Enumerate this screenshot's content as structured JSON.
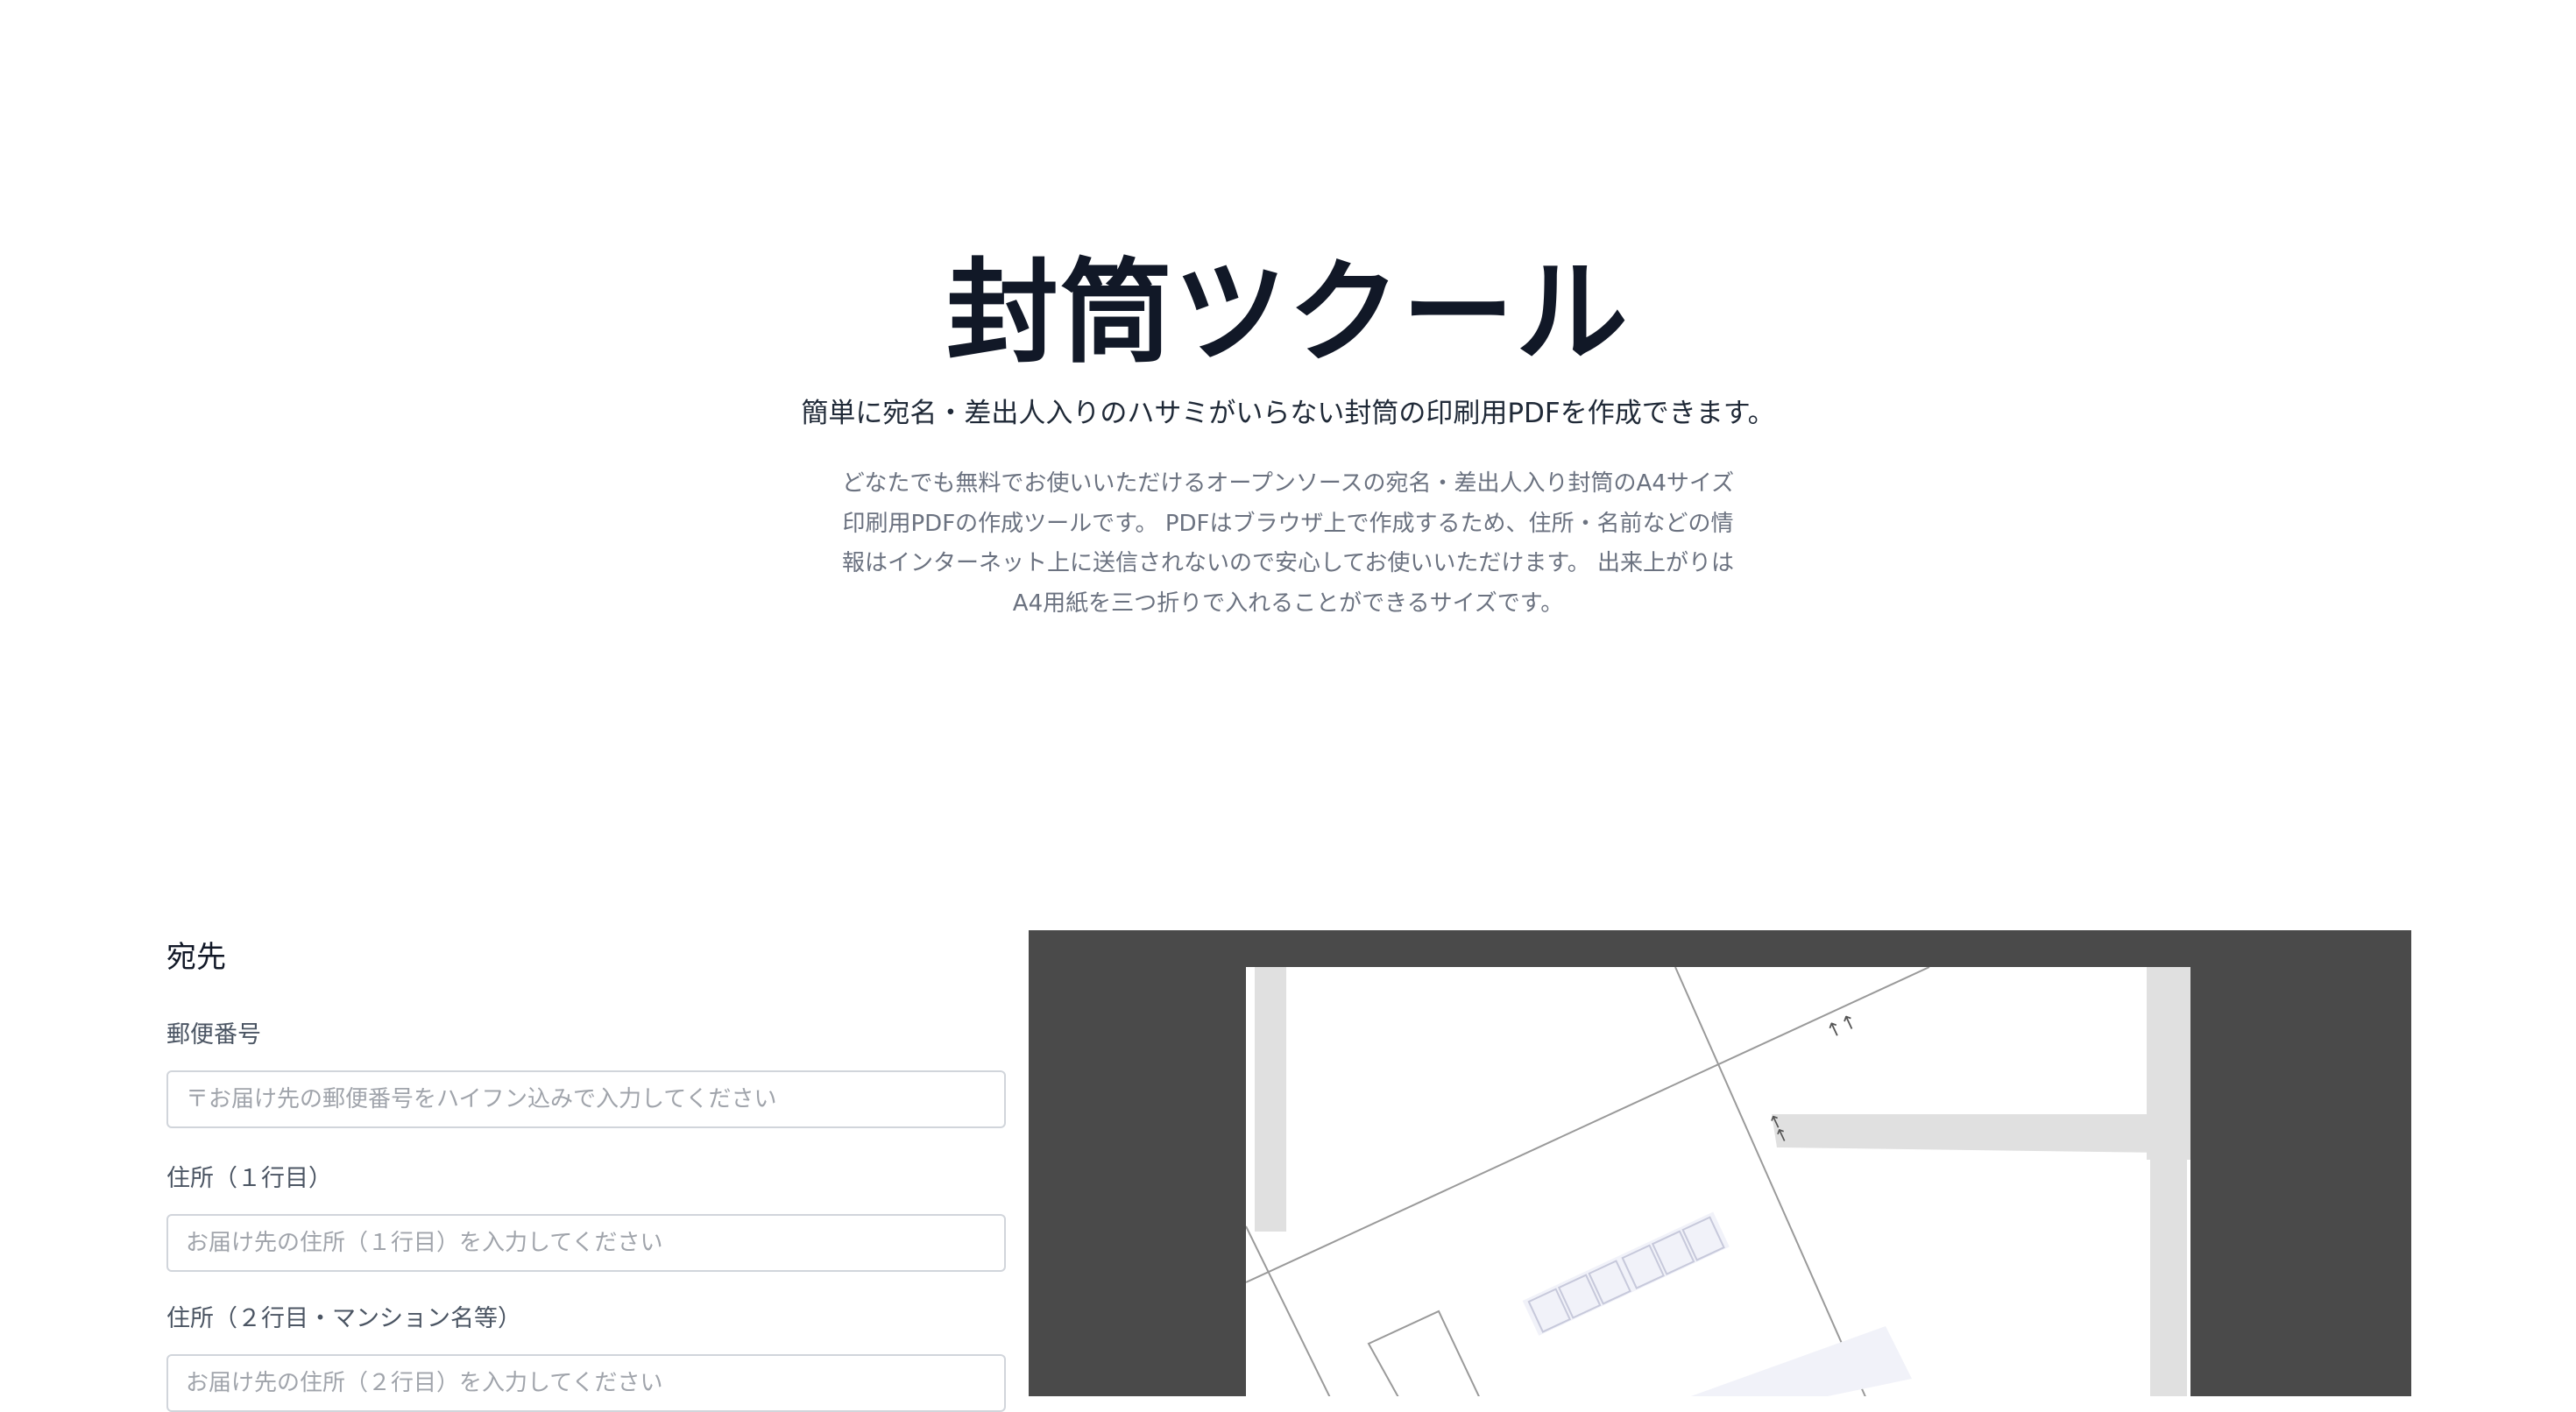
{
  "hero": {
    "title": "封筒ツクール",
    "subtitle": "簡単に宛名・差出人入りのハサミがいらない封筒の印刷用PDFを作成できます。",
    "description": "どなたでも無料でお使いいただけるオープンソースの宛名・差出人入り封筒のA4サイズ印刷用PDFの作成ツールです。 PDFはブラウザ上で作成するため、住所・名前などの情報はインターネット上に送信されないので安心してお使いいただけます。 出来上がりはA4用紙を三つ折りで入れることができるサイズです。"
  },
  "form": {
    "section_heading": "宛先",
    "postal_code": {
      "label": "郵便番号",
      "value": "",
      "placeholder": "〒お届け先の郵便番号をハイフン込みで入力してください"
    },
    "address_line1": {
      "label": "住所（１行目）",
      "value": "",
      "placeholder": "お届け先の住所（１行目）を入力してください"
    },
    "address_line2": {
      "label": "住所（２行目・マンション名等）",
      "value": "",
      "placeholder": "お届け先の住所（２行目）を入力してください"
    }
  },
  "preview": {
    "fold_arrows_top": "↑↑",
    "fold_arrows_side": "←←",
    "colors": {
      "background": "#4a4a4a",
      "paper": "#ffffff",
      "glue_strip": "#e0e0e0",
      "postal_box": "#f1f2f9",
      "fold_line": "#9a9a9a"
    }
  }
}
